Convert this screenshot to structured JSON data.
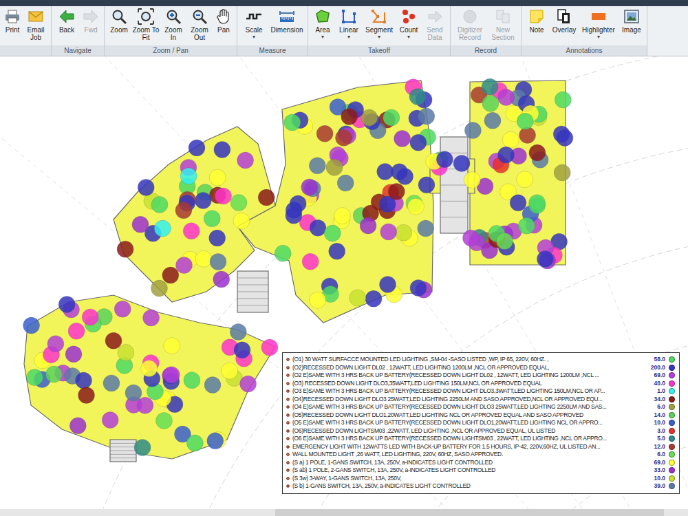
{
  "toolbar": {
    "groups": [
      {
        "buttons": [
          {
            "label": "Print",
            "disabled": false
          },
          {
            "label": "Email Job",
            "disabled": false
          }
        ]
      },
      {
        "label": "Navigate",
        "buttons": [
          {
            "label": "Back",
            "disabled": false
          },
          {
            "label": "Fwd",
            "disabled": true
          }
        ]
      },
      {
        "label": "Zoom / Pan",
        "buttons": [
          {
            "label": "Zoom",
            "disabled": false
          },
          {
            "label": "Zoom To Fit",
            "disabled": false
          },
          {
            "label": "Zoom In",
            "disabled": false
          },
          {
            "label": "Zoom Out",
            "disabled": false
          },
          {
            "label": "Pan",
            "disabled": false
          }
        ]
      },
      {
        "label": "Measure",
        "buttons": [
          {
            "label": "Scale",
            "arrow": "▾",
            "disabled": false
          },
          {
            "label": "Dimension",
            "disabled": false
          }
        ]
      },
      {
        "label": "Takeoff",
        "buttons": [
          {
            "label": "Area",
            "arrow": "▾",
            "disabled": false
          },
          {
            "label": "Linear",
            "arrow": "▾",
            "disabled": false
          },
          {
            "label": "Segment",
            "arrow": "▾",
            "disabled": false
          },
          {
            "label": "Count",
            "arrow": "▾",
            "disabled": false
          },
          {
            "label": "Send Data",
            "disabled": true
          }
        ]
      },
      {
        "label": "Record",
        "buttons": [
          {
            "label": "Digitizer Record",
            "disabled": true
          },
          {
            "label": "New Section",
            "disabled": true
          }
        ]
      },
      {
        "label": "Annotations",
        "buttons": [
          {
            "label": "Note",
            "disabled": false
          },
          {
            "label": "Overlay",
            "disabled": false
          },
          {
            "label": "Highlighter",
            "arrow": "▾",
            "disabled": false
          },
          {
            "label": "Image",
            "disabled": false
          }
        ]
      }
    ]
  },
  "takeoff_legend": {
    "items": [
      {
        "label": "(O1) 30 WATT SURFACCE MOUNTED LED LIGHTING ,SM-04 -SASO LISTED ,WP, IP 65, 220V, 60HZ. ,",
        "count": "58.0",
        "color": "#4cd964"
      },
      {
        "label": "(O2)RECESSED DOWN LIGHT DL02 , 12WATT, LED LIGHTING 1200LM ,NCL OR APPROVED EQUAL,",
        "count": "200.0",
        "color": "#3535c0"
      },
      {
        "label": "(O2 E)SAME WITH 3 HRS BACK UP BATTERY(RECESSED DOWN LIGHT DL02 , 12WATT, LED LIGHTING 1200LM ,NCL ...",
        "count": "69.0",
        "color": "#b43ed8"
      },
      {
        "label": "(O3) RECESSED DOWN LIGHT DLO3,35WATT,LED LIGHTING 150LM,NCL OR APPROVED EQUAL",
        "count": "40.0",
        "color": "#ff33cc"
      },
      {
        "label": "(O3 E)SAME WITH 3 HRS BACK UP BATTERY(RECESSED DOWN LIGHT DLO3,3WATT,LED LIGHTING 150LM,NCL OR AP...",
        "count": "1.0",
        "color": "#33f0f0"
      },
      {
        "label": "(O4)RECESSED DOWN LIGHT DLO3 25WATT,LED LIGHTING 2250LM AND SASO APPROVED,NCL OR APPROVED EQU...",
        "count": "34.0",
        "color": "#8b1a1a"
      },
      {
        "label": "(O4 E)SAME WITH 3 HRS BACK UP BATTERY(RECESSED DOWN LIGHT DLO3 25WATT,LED LIGHTING 2250LM AND SAS...",
        "count": "6.0",
        "color": "#a0a040"
      },
      {
        "label": "(O5)RECESSED DOWN LIGHT DLO1,20WATT,LED LIGHTING NCL OR APPROVED EQUAL AND SASO APPROVED",
        "count": "14.0",
        "color": "#5ad25a"
      },
      {
        "label": "(O5 E)SAME WITH 3 HRS BACK UP BATTERY(RECESSED DOWN LIGHT DLO1,20WATT,LED LIGHTING NCL OR APPRO...",
        "count": "10.0",
        "color": "#3a5fd0"
      },
      {
        "label": "(O6)RECESSED DOWN LIGHTSM03 ,22WATT, LED LIGHTING ,NCL OR APPROVED EQUAL, UL LISTED",
        "count": "3.0",
        "color": "#e8302a"
      },
      {
        "label": "(O6 E)SAME WITH 3 HRS BACK UP BATTERY(RECESSED DOWN LIGHTSM03 , 22WATT, LED LIGHTING ,NCL OR APPRO...",
        "count": "5.0",
        "color": "#2e8b8b"
      },
      {
        "label": "EMERGENCY LIGHT WITH 12WATTS LED WITH BACK-UP BATTERY FOR 1.5 HOURS, IP-42, 220V,60HZ, UL LISTED AN...",
        "count": "12.0",
        "color": "#a83a32"
      },
      {
        "label": "WALL MOUNTED LIGHT ,26 WATT, LED LIGHTING, 220V, 60HZ, SASO APPROVED.",
        "count": "6.0",
        "color": "#66dd55"
      },
      {
        "label": "(S a) 1 POLE, 1-GANS SWITCH, 13A, 250V, a-INDICATES LIGHT CONTROLLED",
        "count": "69.0",
        "color": "#ffff33"
      },
      {
        "label": "(S ab) 1 POLE, 2-GANS SWITCH, 13A, 250V, a-INDICATES LIGHT CONTROLLED",
        "count": "33.0",
        "color": "#9b30d0"
      },
      {
        "label": "(S 3w) 3-WAY, 1-GANS SWITCH, 13A, 250V,",
        "count": "10.0",
        "color": "#c8e030"
      },
      {
        "label": "(S b) 1-GANS SWITCH, 13A, 250V, a-INDICATES LIGHT CONTROLLED",
        "count": "39.0",
        "color": "#5a7aa8"
      }
    ]
  }
}
